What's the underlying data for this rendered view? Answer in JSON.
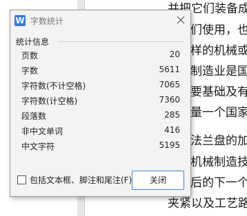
{
  "document": {
    "lines": [
      "并把它们装备成",
      "们使用，也",
      "样的机械或",
      "制造业是国",
      "要基础及有",
      "量一个国家",
      "",
      "法兰盘的加",
      "机械制造技",
      "后的下一个",
      "夹紧以及工艺路"
    ]
  },
  "dialog": {
    "title": "字数统计",
    "app_icon_letter": "W",
    "section_title": "统计信息",
    "stats": [
      {
        "label": "页数",
        "value": "20"
      },
      {
        "label": "字数",
        "value": "5611"
      },
      {
        "label": "字符数(不计空格)",
        "value": "7065"
      },
      {
        "label": "字符数(计空格)",
        "value": "7360"
      },
      {
        "label": "段落数",
        "value": "285"
      },
      {
        "label": "非中文单词",
        "value": "416"
      },
      {
        "label": "中文字符",
        "value": "5195"
      }
    ],
    "checkbox_label": "包括文本框、脚注和尾注(F)",
    "checkbox_checked": false,
    "close_button": "关闭"
  },
  "colors": {
    "accent": "#3f80d9",
    "app_icon": "#2a7de1"
  }
}
